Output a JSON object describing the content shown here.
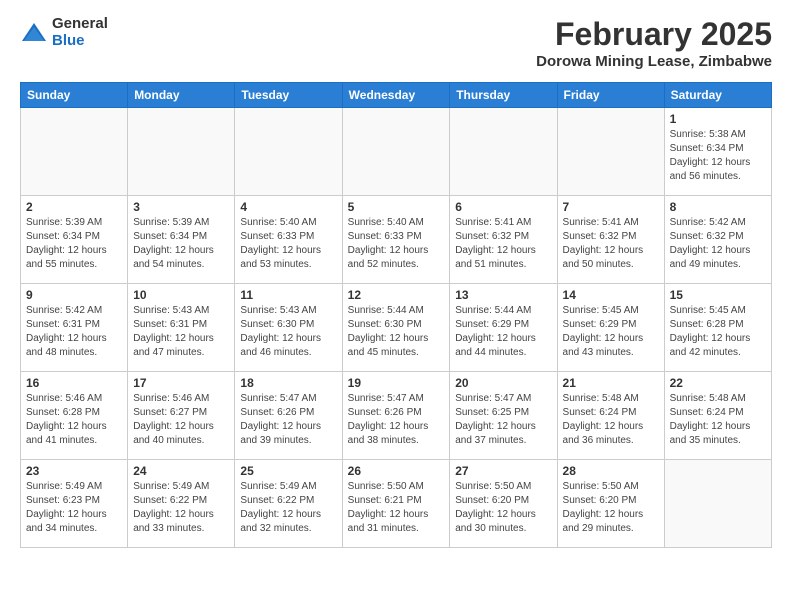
{
  "header": {
    "logo_general": "General",
    "logo_blue": "Blue",
    "month_title": "February 2025",
    "location": "Dorowa Mining Lease, Zimbabwe"
  },
  "weekdays": [
    "Sunday",
    "Monday",
    "Tuesday",
    "Wednesday",
    "Thursday",
    "Friday",
    "Saturday"
  ],
  "weeks": [
    [
      {
        "day": "",
        "info": ""
      },
      {
        "day": "",
        "info": ""
      },
      {
        "day": "",
        "info": ""
      },
      {
        "day": "",
        "info": ""
      },
      {
        "day": "",
        "info": ""
      },
      {
        "day": "",
        "info": ""
      },
      {
        "day": "1",
        "info": "Sunrise: 5:38 AM\nSunset: 6:34 PM\nDaylight: 12 hours\nand 56 minutes."
      }
    ],
    [
      {
        "day": "2",
        "info": "Sunrise: 5:39 AM\nSunset: 6:34 PM\nDaylight: 12 hours\nand 55 minutes."
      },
      {
        "day": "3",
        "info": "Sunrise: 5:39 AM\nSunset: 6:34 PM\nDaylight: 12 hours\nand 54 minutes."
      },
      {
        "day": "4",
        "info": "Sunrise: 5:40 AM\nSunset: 6:33 PM\nDaylight: 12 hours\nand 53 minutes."
      },
      {
        "day": "5",
        "info": "Sunrise: 5:40 AM\nSunset: 6:33 PM\nDaylight: 12 hours\nand 52 minutes."
      },
      {
        "day": "6",
        "info": "Sunrise: 5:41 AM\nSunset: 6:32 PM\nDaylight: 12 hours\nand 51 minutes."
      },
      {
        "day": "7",
        "info": "Sunrise: 5:41 AM\nSunset: 6:32 PM\nDaylight: 12 hours\nand 50 minutes."
      },
      {
        "day": "8",
        "info": "Sunrise: 5:42 AM\nSunset: 6:32 PM\nDaylight: 12 hours\nand 49 minutes."
      }
    ],
    [
      {
        "day": "9",
        "info": "Sunrise: 5:42 AM\nSunset: 6:31 PM\nDaylight: 12 hours\nand 48 minutes."
      },
      {
        "day": "10",
        "info": "Sunrise: 5:43 AM\nSunset: 6:31 PM\nDaylight: 12 hours\nand 47 minutes."
      },
      {
        "day": "11",
        "info": "Sunrise: 5:43 AM\nSunset: 6:30 PM\nDaylight: 12 hours\nand 46 minutes."
      },
      {
        "day": "12",
        "info": "Sunrise: 5:44 AM\nSunset: 6:30 PM\nDaylight: 12 hours\nand 45 minutes."
      },
      {
        "day": "13",
        "info": "Sunrise: 5:44 AM\nSunset: 6:29 PM\nDaylight: 12 hours\nand 44 minutes."
      },
      {
        "day": "14",
        "info": "Sunrise: 5:45 AM\nSunset: 6:29 PM\nDaylight: 12 hours\nand 43 minutes."
      },
      {
        "day": "15",
        "info": "Sunrise: 5:45 AM\nSunset: 6:28 PM\nDaylight: 12 hours\nand 42 minutes."
      }
    ],
    [
      {
        "day": "16",
        "info": "Sunrise: 5:46 AM\nSunset: 6:28 PM\nDaylight: 12 hours\nand 41 minutes."
      },
      {
        "day": "17",
        "info": "Sunrise: 5:46 AM\nSunset: 6:27 PM\nDaylight: 12 hours\nand 40 minutes."
      },
      {
        "day": "18",
        "info": "Sunrise: 5:47 AM\nSunset: 6:26 PM\nDaylight: 12 hours\nand 39 minutes."
      },
      {
        "day": "19",
        "info": "Sunrise: 5:47 AM\nSunset: 6:26 PM\nDaylight: 12 hours\nand 38 minutes."
      },
      {
        "day": "20",
        "info": "Sunrise: 5:47 AM\nSunset: 6:25 PM\nDaylight: 12 hours\nand 37 minutes."
      },
      {
        "day": "21",
        "info": "Sunrise: 5:48 AM\nSunset: 6:24 PM\nDaylight: 12 hours\nand 36 minutes."
      },
      {
        "day": "22",
        "info": "Sunrise: 5:48 AM\nSunset: 6:24 PM\nDaylight: 12 hours\nand 35 minutes."
      }
    ],
    [
      {
        "day": "23",
        "info": "Sunrise: 5:49 AM\nSunset: 6:23 PM\nDaylight: 12 hours\nand 34 minutes."
      },
      {
        "day": "24",
        "info": "Sunrise: 5:49 AM\nSunset: 6:22 PM\nDaylight: 12 hours\nand 33 minutes."
      },
      {
        "day": "25",
        "info": "Sunrise: 5:49 AM\nSunset: 6:22 PM\nDaylight: 12 hours\nand 32 minutes."
      },
      {
        "day": "26",
        "info": "Sunrise: 5:50 AM\nSunset: 6:21 PM\nDaylight: 12 hours\nand 31 minutes."
      },
      {
        "day": "27",
        "info": "Sunrise: 5:50 AM\nSunset: 6:20 PM\nDaylight: 12 hours\nand 30 minutes."
      },
      {
        "day": "28",
        "info": "Sunrise: 5:50 AM\nSunset: 6:20 PM\nDaylight: 12 hours\nand 29 minutes."
      },
      {
        "day": "",
        "info": ""
      }
    ]
  ]
}
